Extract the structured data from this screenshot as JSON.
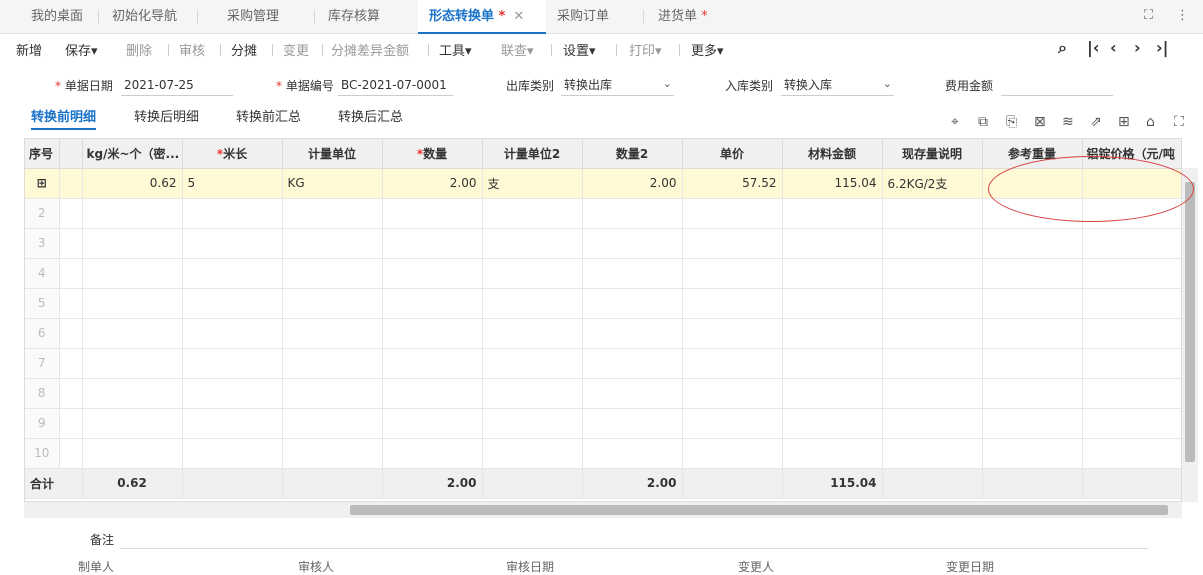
{
  "tabs": [
    {
      "label": "我的桌面",
      "star": ""
    },
    {
      "label": "初始化导航",
      "star": ""
    },
    {
      "label": "采购管理",
      "star": ""
    },
    {
      "label": "库存核算",
      "star": ""
    },
    {
      "label": "形态转换单",
      "star": "*"
    },
    {
      "label": "采购订单",
      "star": ""
    },
    {
      "label": "进货单",
      "star": "*"
    }
  ],
  "toolbar": {
    "items": [
      "新增",
      "保存",
      "删除",
      "审核",
      "分摊",
      "变更",
      "分摊差异金额",
      "工具",
      "联查",
      "设置",
      "打印",
      "更多"
    ]
  },
  "form": {
    "date_label": "单据日期",
    "date": "2021-07-25",
    "no_label": "单据编号",
    "no": "BC-2021-07-0001",
    "out_label": "出库类别",
    "out": "转换出库",
    "in_label": "入库类别",
    "in": "转换入库",
    "fee_label": "费用金额",
    "fee": ""
  },
  "subtabs": [
    "转换前明细",
    "转换后明细",
    "转换前汇总",
    "转换后汇总"
  ],
  "grid": {
    "headers": [
      "序号",
      "kg/米~个（密...",
      "米长",
      "计量单位",
      "数量",
      "计量单位2",
      "数量2",
      "单价",
      "材料金额",
      "现存量说明",
      "参考重量",
      "铝锭价格（元/吨"
    ],
    "row1": {
      "rownum": "⊞",
      "density": "0.62",
      "length": "5",
      "unit": "KG",
      "qty": "2.00",
      "unit2": "支",
      "qty2": "2.00",
      "price": "57.52",
      "amount": "115.04",
      "stock": "6.2KG/2支",
      "refweight": "",
      "alprice": ""
    },
    "empty_rows": [
      "2",
      "3",
      "4",
      "5",
      "6",
      "7",
      "8",
      "9",
      "10"
    ],
    "footer": {
      "label": "合计",
      "density": "0.62",
      "qty": "2.00",
      "qty2": "2.00",
      "amount": "115.04"
    }
  },
  "remark_label": "备注",
  "bottom": [
    "制单人",
    "审核人",
    "审核日期",
    "变更人",
    "变更日期"
  ]
}
